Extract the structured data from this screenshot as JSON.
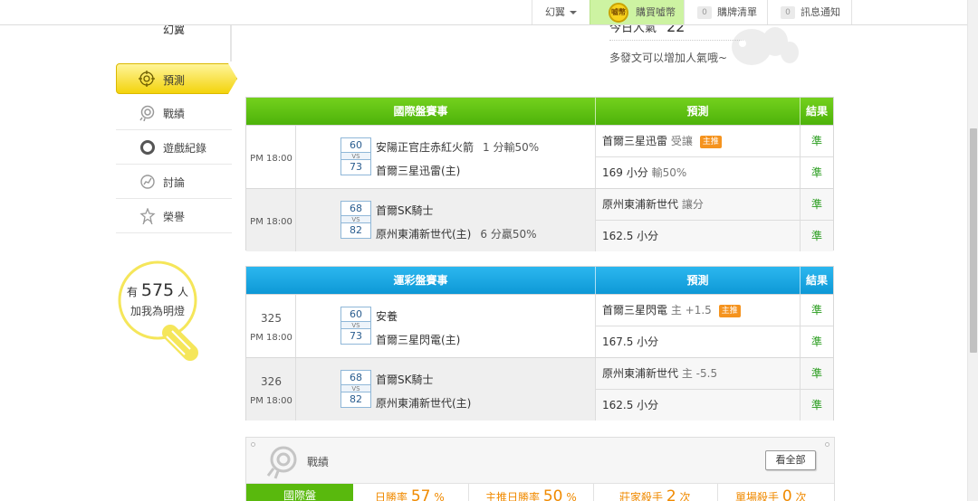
{
  "topbar": {
    "user_label": "幻翼",
    "buy_label": "購買噓幣",
    "coin_text": "噓幣",
    "cart_count": "0",
    "cart_label": "購牌清單",
    "msg_count": "0",
    "msg_label": "訊息通知"
  },
  "profile": {
    "name": "幻翼",
    "popularity_label": "今日人氣",
    "popularity_value": "22",
    "popularity_hint": "多發文可以增加人氣哦~"
  },
  "nav": {
    "items": [
      {
        "label": "預測",
        "icon": "target-icon",
        "active": true
      },
      {
        "label": "戰績",
        "icon": "record-icon"
      },
      {
        "label": "遊戲紀錄",
        "icon": "ring-icon"
      },
      {
        "label": "討論",
        "icon": "discussion-icon"
      },
      {
        "label": "榮譽",
        "icon": "medal-icon"
      }
    ]
  },
  "bulb": {
    "prefix": "有",
    "count": "575",
    "suffix": "人",
    "line2": "加我為明燈"
  },
  "intl_table": {
    "header_event": "國際盤賽事",
    "header_pred": "預測",
    "header_result": "結果",
    "rows": [
      {
        "time": "PM 18:00",
        "score_a": "60",
        "vs": "VS",
        "score_b": "73",
        "team_a": "安陽正官庄赤紅火箭",
        "team_a_odds": "1 分輸50%",
        "team_b": "首爾三星迅雷(主)",
        "team_b_odds": "",
        "pred_top": "首爾三星迅雷",
        "pred_top_sub": "受讓",
        "pred_top_tag": "主推",
        "pred_bot": "169 小分",
        "pred_bot_sub": "輸50%",
        "res_top": "準",
        "res_bot": "準"
      },
      {
        "time": "PM 18:00",
        "score_a": "68",
        "vs": "VS",
        "score_b": "82",
        "team_a": "首爾SK騎士",
        "team_a_odds": "",
        "team_b": "原州東浦新世代(主)",
        "team_b_odds": "6 分贏50%",
        "pred_top": "原州東浦新世代",
        "pred_top_sub": "讓分",
        "pred_top_tag": "",
        "pred_bot": "162.5 小分",
        "pred_bot_sub": "",
        "res_top": "準",
        "res_bot": "準"
      }
    ]
  },
  "lottery_table": {
    "header_event": "運彩盤賽事",
    "header_pred": "預測",
    "header_result": "結果",
    "rows": [
      {
        "num": "325",
        "time": "PM 18:00",
        "score_a": "60",
        "vs": "VS",
        "score_b": "73",
        "team_a": "安養",
        "team_a_odds": "",
        "team_b": "首爾三星閃電(主)",
        "team_b_odds": "",
        "pred_top": "首爾三星閃電",
        "pred_top_sub": "主 +1.5",
        "pred_top_tag": "主推",
        "pred_bot": "167.5 小分",
        "pred_bot_sub": "",
        "res_top": "準",
        "res_bot": "準"
      },
      {
        "num": "326",
        "time": "PM 18:00",
        "score_a": "68",
        "vs": "VS",
        "score_b": "82",
        "team_a": "首爾SK騎士",
        "team_a_odds": "",
        "team_b": "原州東浦新世代(主)",
        "team_b_odds": "",
        "pred_top": "原州東浦新世代",
        "pred_top_sub": "主 -5.5",
        "pred_top_tag": "",
        "pred_bot": "162.5 小分",
        "pred_bot_sub": "",
        "res_top": "準",
        "res_bot": "準"
      }
    ]
  },
  "record_panel": {
    "title": "戰績",
    "view_all": "看全部",
    "tab": "國際盤",
    "stat1_label": "日勝率",
    "stat1_value": "57",
    "stat1_unit": "%",
    "stat2_label": "主推日勝率",
    "stat2_value": "50",
    "stat2_unit": "%",
    "stat3_label": "莊家殺手",
    "stat3_value": "2",
    "stat3_unit": "次",
    "stat4_label": "單場殺手",
    "stat4_value": "0",
    "stat4_unit": "次"
  },
  "colors": {
    "intl_header": "#5cbd12",
    "lottery_header": "#1aa7e4",
    "result_text": "#2a9d1f",
    "tag_orange": "#f5931e",
    "active_nav": "#f3d30c"
  }
}
